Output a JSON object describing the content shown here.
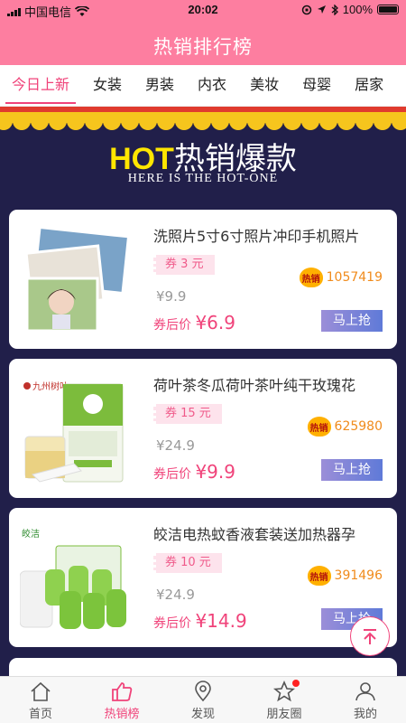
{
  "status": {
    "carrier": "中国电信",
    "time": "20:02",
    "battery": "100%"
  },
  "header": {
    "title": "热销排行榜"
  },
  "tabs": [
    {
      "label": "今日上新",
      "active": true
    },
    {
      "label": "女装"
    },
    {
      "label": "男装"
    },
    {
      "label": "内衣"
    },
    {
      "label": "美妆"
    },
    {
      "label": "母婴"
    },
    {
      "label": "居家"
    }
  ],
  "banner": {
    "hot": "HOT",
    "hot_cn": "热销爆款",
    "subtitle": "HERE IS THE HOT-ONE"
  },
  "products": [
    {
      "name": "洗照片5寸6寸照片冲印手机照片",
      "coupon": "券 3 元",
      "orig_price": "¥9.9",
      "after_label": "券后价",
      "after_price": "¥6.9",
      "sales": "1057419",
      "buy": "马上抢",
      "badge": "热销"
    },
    {
      "name": "荷叶茶冬瓜荷叶茶叶纯干玫瑰花",
      "coupon": "券 15 元",
      "orig_price": "¥24.9",
      "after_label": "券后价",
      "after_price": "¥9.9",
      "sales": "625980",
      "buy": "马上抢",
      "badge": "热销"
    },
    {
      "name": "皎洁电热蚊香液套装送加热器孕",
      "coupon": "券 10 元",
      "orig_price": "¥24.9",
      "after_label": "券后价",
      "after_price": "¥14.9",
      "sales": "391496",
      "buy": "马上抢",
      "badge": "热销"
    }
  ],
  "product_images": {
    "brand2": "九州树叶",
    "brand3": "皎洁"
  },
  "bottom_nav": [
    {
      "label": "首页",
      "icon": "home-icon"
    },
    {
      "label": "热销榜",
      "icon": "thumbs-up-icon",
      "active": true
    },
    {
      "label": "发现",
      "icon": "location-icon"
    },
    {
      "label": "朋友圈",
      "icon": "star-icon",
      "badge": true
    },
    {
      "label": "我的",
      "icon": "user-icon"
    }
  ],
  "colors": {
    "brand": "#fd7ea0",
    "accent": "#f0437a",
    "banner_bg": "#211f4a"
  }
}
